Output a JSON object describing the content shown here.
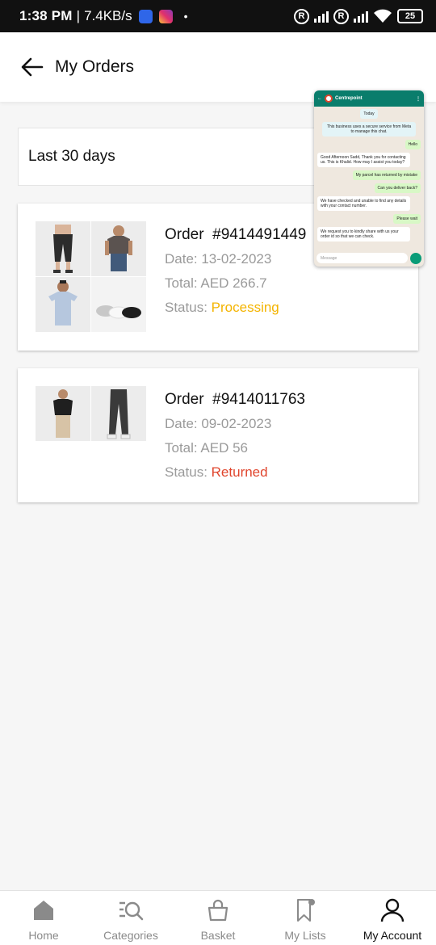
{
  "status_bar": {
    "time": "1:38 PM",
    "separator": "|",
    "network_speed": "7.4KB/s",
    "dot": "•",
    "roaming_badge": "R",
    "battery": "25"
  },
  "header": {
    "back_icon": "arrow-left-icon",
    "title": "My Orders"
  },
  "filter": {
    "label": "Last 30 days"
  },
  "orders": [
    {
      "order_label": "Order",
      "order_number": "#9414491449",
      "date": "Date: 13-02-2023",
      "total": "Total: AED 266.7",
      "status_label": "Status:",
      "status_value": "Processing",
      "status_color": "#f4b400"
    },
    {
      "order_label": "Order",
      "order_number": "#9414011763",
      "date": "Date: 09-02-2023",
      "total": "Total: AED 56",
      "status_label": "Status:",
      "status_value": "Returned",
      "status_color": "#e0452d"
    }
  ],
  "pip_chat": {
    "contact": "Centrepoint",
    "messages": [
      {
        "type": "sys",
        "text": "Today"
      },
      {
        "type": "sys",
        "text": "This business uses a secure service from Meta to manage this chat."
      },
      {
        "type": "out",
        "text": "Hello"
      },
      {
        "type": "in",
        "text": "Good Afternoon Sadd, Thank you for contacting us. This is Khalid. How may I assist you today?"
      },
      {
        "type": "out",
        "text": "My parcel has returned by mistake"
      },
      {
        "type": "out",
        "text": "Can you deliver back?"
      },
      {
        "type": "in",
        "text": "We have checked and unable to find any details with your contact number."
      },
      {
        "type": "out",
        "text": "Please wait"
      },
      {
        "type": "in",
        "text": "We request you to kindly share with us your order id so that we can check."
      }
    ],
    "input_placeholder": "Message"
  },
  "bottom_nav": [
    {
      "label": "Home",
      "icon": "home-icon",
      "active": false
    },
    {
      "label": "Categories",
      "icon": "categories-search-icon",
      "active": false
    },
    {
      "label": "Basket",
      "icon": "basket-icon",
      "active": false
    },
    {
      "label": "My Lists",
      "icon": "bookmark-icon",
      "active": false
    },
    {
      "label": "My Account",
      "icon": "user-icon",
      "active": true
    }
  ],
  "colors": {
    "processing": "#f4b400",
    "returned": "#e0452d",
    "whatsapp_green": "#0a7d6c"
  }
}
